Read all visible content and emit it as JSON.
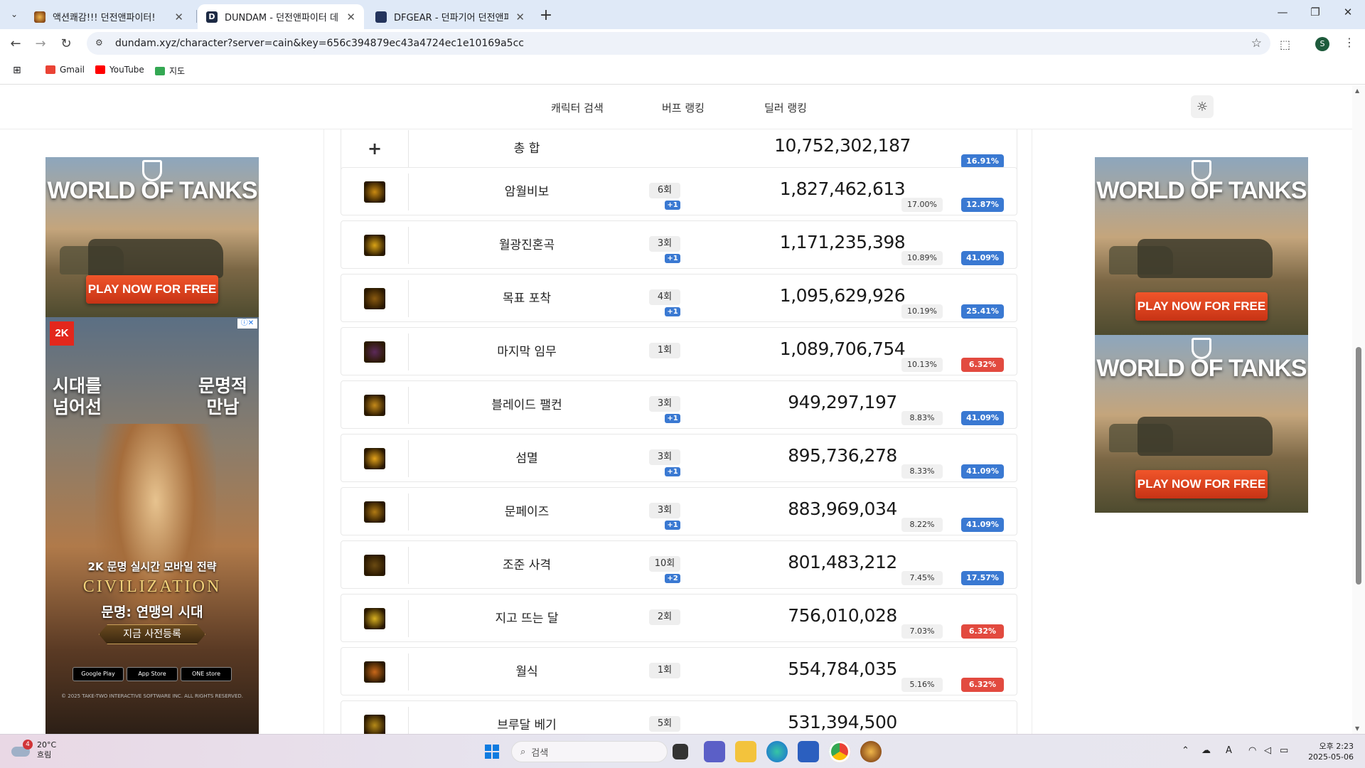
{
  "browser": {
    "tabs": [
      {
        "label": "액션쾌감!!! 던전앤파이터!",
        "active": false
      },
      {
        "label": "DUNDAM - 던전앤파이터 데미",
        "active": true
      },
      {
        "label": "DFGEAR - 던파기어 던전앤파이",
        "active": false
      }
    ],
    "url": "dundam.xyz/character?server=cain&key=656c394879ec43a4724ec1e10169a5cc",
    "profile_initial": "S",
    "bookmarks": [
      {
        "label": "Gmail",
        "color": "#ea4335"
      },
      {
        "label": "YouTube",
        "color": "#ff0000"
      },
      {
        "label": "지도",
        "color": "#34a853"
      }
    ]
  },
  "site_nav": {
    "items": [
      "캐릭터 검색",
      "버프 랭킹",
      "딜러 랭킹"
    ],
    "theme_icon": "sun-icon"
  },
  "total_row": {
    "label": "총 합",
    "damage": "10,752,302,187",
    "pct": "16.91%",
    "pct_color": "blue"
  },
  "skills": [
    {
      "name": "암월비보",
      "count": "6회",
      "boost": "+1",
      "damage": "1,827,462,613",
      "share": "17.00%",
      "pct": "12.87%",
      "pct_color": "blue",
      "icon_color": "#c98a12"
    },
    {
      "name": "월광진혼곡",
      "count": "3회",
      "boost": "+1",
      "damage": "1,171,235,398",
      "share": "10.89%",
      "pct": "41.09%",
      "pct_color": "blue",
      "icon_color": "#d9a316"
    },
    {
      "name": "목표 포착",
      "count": "4회",
      "boost": "+1",
      "damage": "1,095,629,926",
      "share": "10.19%",
      "pct": "25.41%",
      "pct_color": "blue",
      "icon_color": "#8a5a10"
    },
    {
      "name": "마지막 임무",
      "count": "1회",
      "boost": "",
      "damage": "1,089,706,754",
      "share": "10.13%",
      "pct": "6.32%",
      "pct_color": "red",
      "icon_color": "#5c2a5a"
    },
    {
      "name": "블레이드 팰컨",
      "count": "3회",
      "boost": "+1",
      "damage": "949,297,197",
      "share": "8.83%",
      "pct": "41.09%",
      "pct_color": "blue",
      "icon_color": "#c48a1a"
    },
    {
      "name": "섬멸",
      "count": "3회",
      "boost": "+1",
      "damage": "895,736,278",
      "share": "8.33%",
      "pct": "41.09%",
      "pct_color": "blue",
      "icon_color": "#e3a21a"
    },
    {
      "name": "문페이즈",
      "count": "3회",
      "boost": "+1",
      "damage": "883,969,034",
      "share": "8.22%",
      "pct": "41.09%",
      "pct_color": "blue",
      "icon_color": "#b07a14"
    },
    {
      "name": "조준 사격",
      "count": "10회",
      "boost": "+2",
      "damage": "801,483,212",
      "share": "7.45%",
      "pct": "17.57%",
      "pct_color": "blue",
      "icon_color": "#6a4a12"
    },
    {
      "name": "지고 뜨는 달",
      "count": "2회",
      "boost": "",
      "damage": "756,010,028",
      "share": "7.03%",
      "pct": "6.32%",
      "pct_color": "red",
      "icon_color": "#d8b020"
    },
    {
      "name": "월식",
      "count": "1회",
      "boost": "",
      "damage": "554,784,035",
      "share": "5.16%",
      "pct": "6.32%",
      "pct_color": "red",
      "icon_color": "#c8681a"
    },
    {
      "name": "브루달 베기",
      "count": "5회",
      "boost": "",
      "damage": "531,394,500",
      "share": "",
      "pct": "",
      "pct_color": "blue",
      "icon_color": "#b58a18"
    }
  ],
  "ads": {
    "wot": {
      "logo": "WORLD OF TANKS",
      "cta": "PLAY NOW FOR FREE"
    },
    "civ": {
      "brand": "2K",
      "headline_left": [
        "시대를",
        "넘어선"
      ],
      "headline_right": [
        "문명적",
        "만남"
      ],
      "subline": "2K 문명 실시간 모바일 전략",
      "logo": "CIVILIZATION",
      "title": "문명: 연맹의 시대",
      "cta": "지금 사전등록",
      "stores": [
        "Google Play",
        "App Store",
        "ONE store"
      ],
      "copyright": "© 2025 TAKE-TWO INTERACTIVE SOFTWARE INC. ALL RIGHTS RESERVED."
    }
  },
  "taskbar": {
    "weather_temp": "20°C",
    "weather_desc": "흐림",
    "weather_badge": "4",
    "search_placeholder": "검색",
    "time": "오후 2:23",
    "date": "2025-05-06"
  }
}
